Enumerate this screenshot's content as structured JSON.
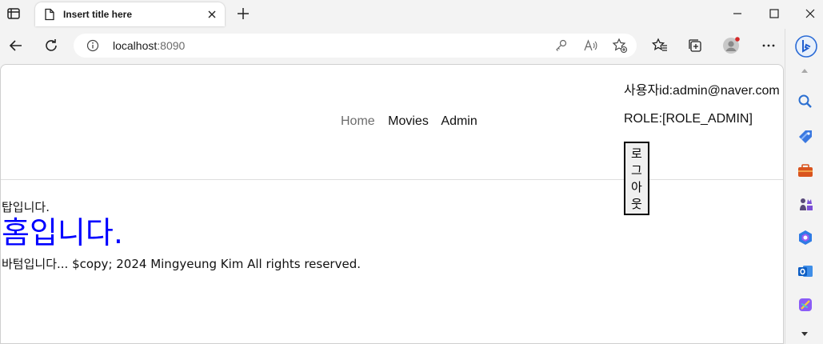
{
  "browser": {
    "tab_title": "Insert title here",
    "url_host": "localhost",
    "url_port": ":8090",
    "icons": {
      "tab_actions": "tab-actions-icon",
      "page": "page-icon",
      "close_tab": "close-icon",
      "new_tab": "plus-icon",
      "back": "back-arrow-icon",
      "refresh": "refresh-icon",
      "site_info": "info-icon",
      "key": "key-icon",
      "read_aloud": "read-aloud-icon",
      "favorite_add": "star-add-icon",
      "favorites": "favorites-icon",
      "collections": "collections-icon",
      "profile": "avatar",
      "menu": "more-icon",
      "copilot": "bing-icon"
    },
    "sidebar": [
      "search-icon",
      "tag-icon",
      "briefcase-icon",
      "games-icon",
      "microsoft365-icon",
      "outlook-icon",
      "designer-icon"
    ]
  },
  "page": {
    "nav": {
      "home": "Home",
      "movies": "Movies",
      "admin": "Admin"
    },
    "user": {
      "id_line": "사용자id:admin@naver.com",
      "role_line": "ROLE:[ROLE_ADMIN]",
      "logout_label": "로그아웃"
    },
    "top_text": "탑입니다.",
    "heading": "홈입니다.",
    "footer_text": "바텀입니다... $copy; 2024 Mingyeung Kim All rights reserved."
  },
  "colors": {
    "heading": "#0000ff",
    "nav_home": "#6c6c6c"
  }
}
